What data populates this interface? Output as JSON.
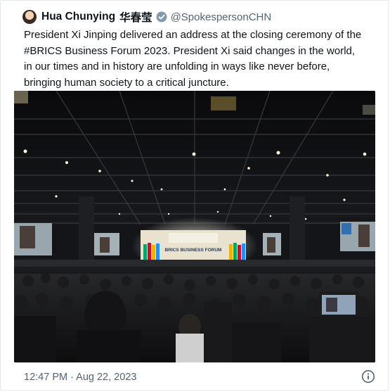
{
  "author": {
    "display_name": "Hua Chunying",
    "chinese_name": "华春莹",
    "handle": "@SpokespersonCHN",
    "verified_icon": "verified-badge-icon"
  },
  "tweet": {
    "lines": [
      "President Xi Jinping delivered an address at the closing ceremony of the",
      "#BRICS Business Forum 2023. President Xi said changes in the world,",
      "in our times and in history are unfolding in ways like never before,",
      "bringing human society to a critical juncture."
    ]
  },
  "media": {
    "stage_banner": "BRICS BUSINESS FORUM",
    "accent_colors": [
      "#00a86b",
      "#c8102e",
      "#f0b400",
      "#1e90ff"
    ]
  },
  "footer": {
    "timestamp": "12:47 PM · Aug 22, 2023",
    "info_icon": "info-icon"
  }
}
